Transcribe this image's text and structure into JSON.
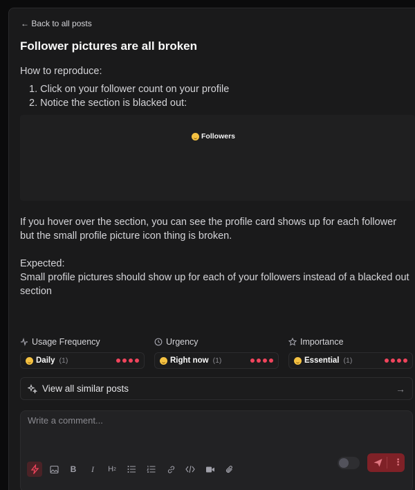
{
  "nav": {
    "back_label": "← Back to all posts"
  },
  "post": {
    "title": "Follower pictures are all broken",
    "repro_heading": "How to reproduce:",
    "steps": [
      "1. Click on your follower count on your profile",
      "2. Notice the section is blacked out:"
    ],
    "preview_label": "Followers",
    "hover_text": "If you hover over the section, you can see the profile card shows up for each follower but the small profile picture icon thing is broken.",
    "expected_heading": "Expected:",
    "expected_text": "Small profile pictures should show up for each of your followers instead of a blacked out section"
  },
  "metrics": [
    {
      "heading": "Usage Frequency",
      "icon": "pulse-icon",
      "value": "Daily",
      "count": "(1)",
      "level": 4
    },
    {
      "heading": "Urgency",
      "icon": "clock-icon",
      "value": "Right now",
      "count": "(1)",
      "level": 4
    },
    {
      "heading": "Importance",
      "icon": "star-icon",
      "value": "Essential",
      "count": "(1)",
      "level": 4
    }
  ],
  "similar": {
    "label": "View all similar posts"
  },
  "comment": {
    "placeholder": "Write a comment..."
  },
  "colors": {
    "accent": "#f0445c",
    "send_bg": "#7f2127",
    "panel": "#1a1a1b"
  }
}
